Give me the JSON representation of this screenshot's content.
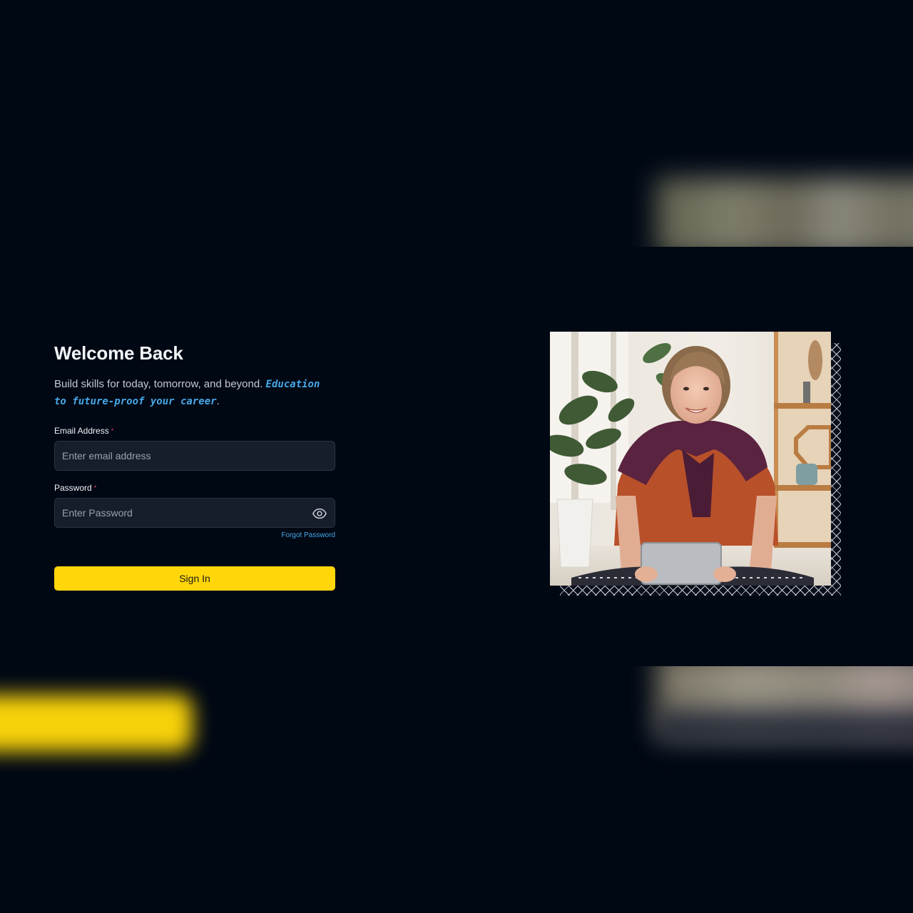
{
  "login": {
    "title": "Welcome Back",
    "subtitle_plain": "Build skills for today, tomorrow, and beyond.",
    "subtitle_highlight": "Education to future-proof your career",
    "subtitle_end": ".",
    "email": {
      "label": "Email Address",
      "required_mark": "*",
      "placeholder": "Enter email address",
      "value": ""
    },
    "password": {
      "label": "Password",
      "required_mark": "*",
      "placeholder": "Enter Password",
      "value": "",
      "toggle_icon": "eye-icon"
    },
    "forgot_link": "Forgot Password",
    "submit_label": "Sign In"
  },
  "theme": {
    "background": "#000814",
    "accent_yellow": "#ffd60a",
    "accent_blue": "#47a7e6",
    "required_red": "#ef476f"
  }
}
